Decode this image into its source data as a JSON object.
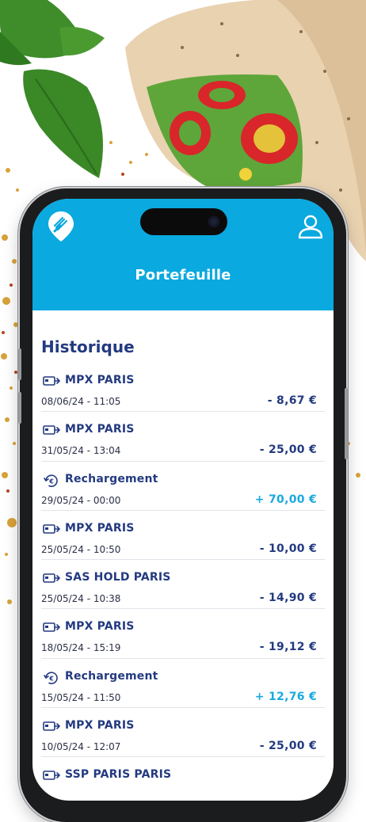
{
  "header": {
    "title": "Portefeuille",
    "logo_icon": "fork-location-pin-icon",
    "profile_icon": "user-profile-icon",
    "color": "#0aa9df"
  },
  "history": {
    "title": "Historique",
    "transactions": [
      {
        "icon": "card-payment-icon",
        "merchant": "MPX PARIS",
        "date": "08/06/24 - 11:05",
        "amount": "- 8,67 €",
        "type": "debit"
      },
      {
        "icon": "card-payment-icon",
        "merchant": "MPX PARIS",
        "date": "31/05/24 - 13:04",
        "amount": "- 25,00 €",
        "type": "debit"
      },
      {
        "icon": "euro-refresh-icon",
        "merchant": "Rechargement",
        "date": "29/05/24 - 00:00",
        "amount": "+ 70,00 €",
        "type": "credit"
      },
      {
        "icon": "card-payment-icon",
        "merchant": "MPX PARIS",
        "date": "25/05/24 - 10:50",
        "amount": "- 10,00 €",
        "type": "debit"
      },
      {
        "icon": "card-payment-icon",
        "merchant": "SAS HOLD PARIS",
        "date": "25/05/24 - 10:38",
        "amount": "- 14,90 €",
        "type": "debit"
      },
      {
        "icon": "card-payment-icon",
        "merchant": "MPX PARIS",
        "date": "18/05/24 - 15:19",
        "amount": "- 19,12 €",
        "type": "debit"
      },
      {
        "icon": "euro-refresh-icon",
        "merchant": "Rechargement",
        "date": "15/05/24 - 11:50",
        "amount": "+ 12,76 €",
        "type": "credit"
      },
      {
        "icon": "card-payment-icon",
        "merchant": "MPX PARIS",
        "date": "10/05/24 - 12:07",
        "amount": "- 25,00 €",
        "type": "debit"
      },
      {
        "icon": "card-payment-icon",
        "merchant": "SSP PARIS PARIS",
        "date": "",
        "amount": "",
        "type": "debit"
      }
    ]
  },
  "colors": {
    "navy": "#233a80",
    "credit": "#19a9df",
    "divider": "#e2e4ea"
  }
}
